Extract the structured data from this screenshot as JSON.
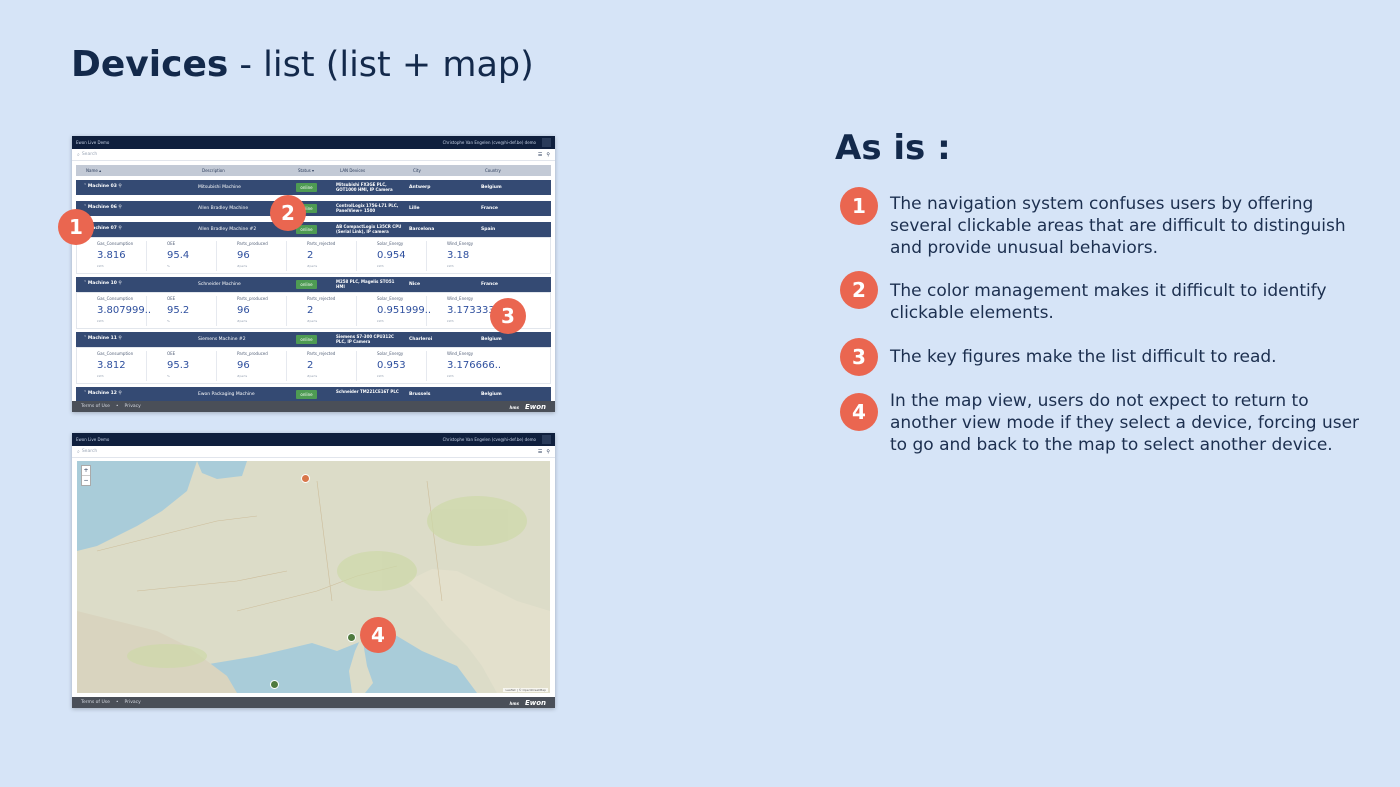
{
  "slide": {
    "title_bold": "Devices",
    "title_rest": " - list (list + map)",
    "as_is": "As is :"
  },
  "issues": [
    {
      "num": "1",
      "text": "The navigation system confuses users by offering several clickable areas that are difficult to distinguish and provide unusual behaviors."
    },
    {
      "num": "2",
      "text": "The color management makes it difficult to identify clickable elements."
    },
    {
      "num": "3",
      "text": "The key figures make the list difficult to read."
    },
    {
      "num": "4",
      "text": "In the map view, users do not expect to return to another view mode if they select a device, forcing user to go and back to the map to select another device."
    }
  ],
  "colors": {
    "background": "#d6e4f7",
    "badge": "#ea6650",
    "header_row": "#344a73",
    "status_online": "#4e9b53"
  },
  "app": {
    "top_left": "Ewon Live Demo",
    "user": "Christophe Van Engelen (cve@hi-def.be) demo",
    "search_placeholder": "Search",
    "list_view_icon": "list-icon",
    "map_view_icon": "map-pin-icon",
    "columns": {
      "name": "Name",
      "description": "Description",
      "status": "Status",
      "lan": "LAN Devices",
      "city": "City",
      "country": "Country"
    },
    "footer": {
      "terms": "Terms of Use",
      "sep": "•",
      "privacy": "Privacy",
      "hms": "hms",
      "logo": "Ewon"
    },
    "zoom_in": "+",
    "zoom_out": "−",
    "map_attribution": "Leaflet | © OpenStreetMap"
  },
  "machines": [
    {
      "name": "Machine 03",
      "description": "Mitsubishi Machine",
      "status": "online",
      "lan": "Mitsubishi FX3GE PLC, GOT1000 HMI, IP Camera",
      "city": "Antwerp",
      "country": "Belgium"
    },
    {
      "name": "Machine 06",
      "description": "Allen Bradley Machine",
      "status": "online",
      "lan": "ControlLogix 1756-L71 PLC, PanelView+ 1500",
      "city": "Lille",
      "country": "France"
    },
    {
      "name": "Machine 07",
      "description": "Allen Bradley Machine #2",
      "status": "online",
      "lan": "AB CompactLogix L35CR CPU (Serial Link), IP camera",
      "city": "Barcelona",
      "country": "Spain",
      "kpis": [
        {
          "label": "Gas_Consumption",
          "value": "3.816",
          "unit": "kWh"
        },
        {
          "label": "OEE",
          "value": "95.4",
          "unit": "%"
        },
        {
          "label": "Parts_produced",
          "value": "96",
          "unit": "#parts"
        },
        {
          "label": "Parts_rejected",
          "value": "2",
          "unit": "#parts"
        },
        {
          "label": "Solar_Energy",
          "value": "0.954",
          "unit": "kWh"
        },
        {
          "label": "Wind_Energy",
          "value": "3.18",
          "unit": "kWh"
        }
      ]
    },
    {
      "name": "Machine 10",
      "description": "Schneider Machine",
      "status": "online",
      "lan": "M258 PLC, Magelis STO51 HMI",
      "city": "Nice",
      "country": "France",
      "kpis": [
        {
          "label": "Gas_Consumption",
          "value": "3.807999..",
          "unit": "kWh"
        },
        {
          "label": "OEE",
          "value": "95.2",
          "unit": "%"
        },
        {
          "label": "Parts_produced",
          "value": "96",
          "unit": "#parts"
        },
        {
          "label": "Parts_rejected",
          "value": "2",
          "unit": "#parts"
        },
        {
          "label": "Solar_Energy",
          "value": "0.951999..",
          "unit": "kWh"
        },
        {
          "label": "Wind_Energy",
          "value": "3.173333",
          "unit": "kWh"
        }
      ]
    },
    {
      "name": "Machine 11",
      "description": "Siemens Machine #2",
      "status": "online",
      "lan": "Siemens S7-300 CPU312C PLC, IP Camera",
      "city": "Charleroi",
      "country": "Belgium",
      "kpis": [
        {
          "label": "Gas_Consumption",
          "value": "3.812",
          "unit": "kWh"
        },
        {
          "label": "OEE",
          "value": "95.3",
          "unit": "%"
        },
        {
          "label": "Parts_produced",
          "value": "96",
          "unit": "#parts"
        },
        {
          "label": "Parts_rejected",
          "value": "2",
          "unit": "#parts"
        },
        {
          "label": "Solar_Energy",
          "value": "0.953",
          "unit": "kWh"
        },
        {
          "label": "Wind_Energy",
          "value": "3.176666..",
          "unit": "kWh"
        }
      ]
    },
    {
      "name": "Machine 12",
      "description": "Ewon Packaging Machine",
      "status": "online",
      "lan": "Schneider TM221CE16T PLC",
      "city": "Brussels",
      "country": "Belgium"
    }
  ]
}
